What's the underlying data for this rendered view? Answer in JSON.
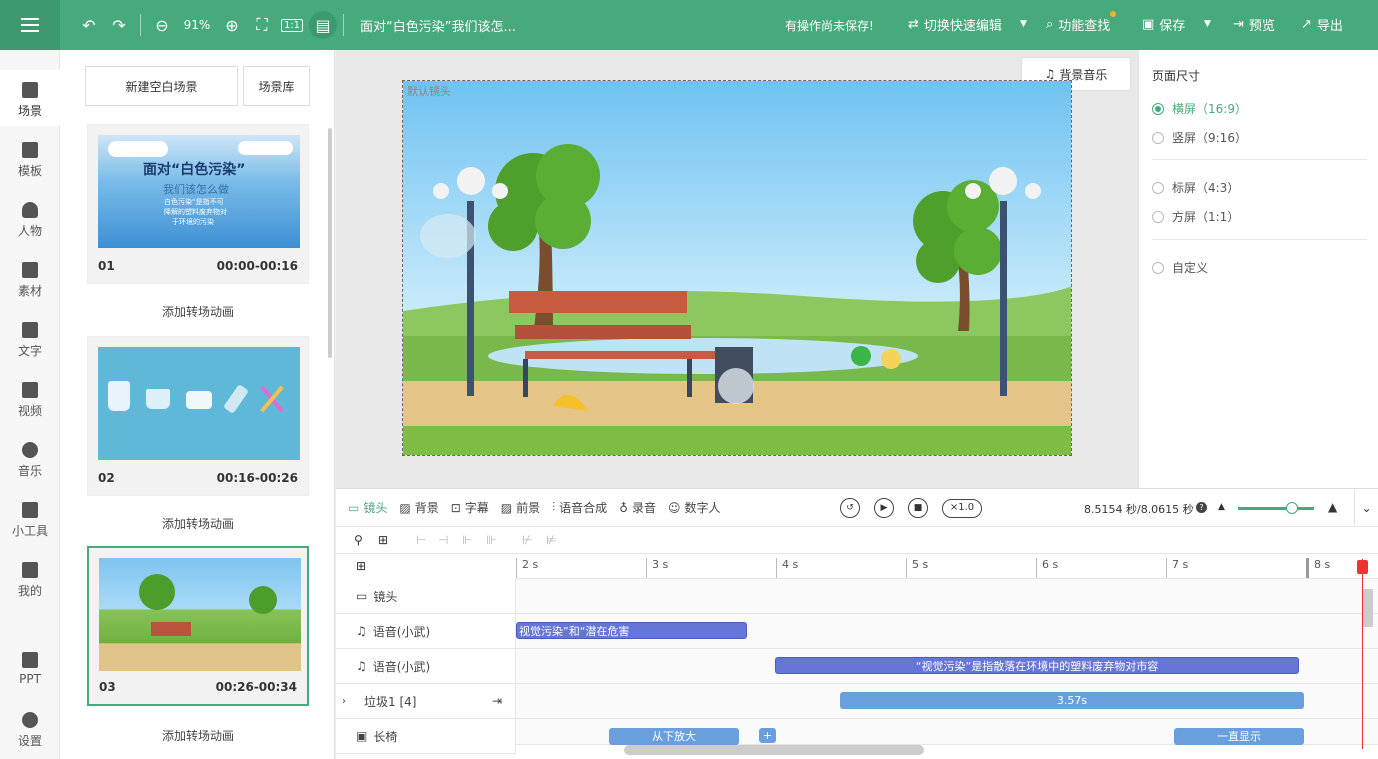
{
  "topbar": {
    "zoom": "91%",
    "doc_title": "面对“白色污染”我们该怎...",
    "unsaved": "有操作尚未保存!",
    "switch_label": "切换快速编辑",
    "find_label": "功能查找",
    "save_label": "保存",
    "preview_label": "预览",
    "export_label": "导出",
    "accent": "#47aa7c"
  },
  "leftnav": {
    "items": [
      {
        "label": "场景",
        "icon": "scene-icon"
      },
      {
        "label": "模板",
        "icon": "template-icon"
      },
      {
        "label": "人物",
        "icon": "person-icon"
      },
      {
        "label": "素材",
        "icon": "material-icon"
      },
      {
        "label": "文字",
        "icon": "text-icon"
      },
      {
        "label": "视频",
        "icon": "video-icon"
      },
      {
        "label": "音乐",
        "icon": "music-icon"
      },
      {
        "label": "小工具",
        "icon": "toolbox-icon"
      },
      {
        "label": "我的",
        "icon": "upload-icon"
      },
      {
        "label": "PPT",
        "icon": "ppt-icon"
      },
      {
        "label": "设置",
        "icon": "gear-icon"
      }
    ]
  },
  "scenes": {
    "new_blank": "新建空白场景",
    "library": "场景库",
    "add_transition": "添加转场动画",
    "items": [
      {
        "num": "01",
        "time": "00:00-00:16",
        "thumb_title": "面对“白色污染”",
        "thumb_sub": "我们该怎么做",
        "thumb_body": [
          "白色污染“是指不可",
          "降解的塑料废弃物对",
          "于环境的污染"
        ]
      },
      {
        "num": "02",
        "time": "00:16-00:26"
      },
      {
        "num": "03",
        "time": "00:26-00:34"
      }
    ]
  },
  "canvas": {
    "bg_music": "背景音乐",
    "cam_label": "默认镜头"
  },
  "page_size": {
    "title": "页面尺寸",
    "options": [
      {
        "label": "横屏（16:9）",
        "selected": true
      },
      {
        "label": "竖屏（9:16）",
        "selected": false
      },
      {
        "label": "标屏（4:3）",
        "selected": false
      },
      {
        "label": "方屏（1:1）",
        "selected": false
      },
      {
        "label": "自定义",
        "selected": false
      }
    ]
  },
  "timeline": {
    "tabs": [
      "镜头",
      "背景",
      "字幕",
      "前景",
      "语音合成",
      "录音",
      "数字人"
    ],
    "speed": "×1.0",
    "timecode": "8.5154 秒/8.0615 秒",
    "ticks": [
      "2 s",
      "3 s",
      "4 s",
      "5 s",
      "6 s",
      "7 s",
      "8 s"
    ],
    "tracks": [
      {
        "label": "镜头",
        "icon": "camera-icon"
      },
      {
        "label": "语音(小武)",
        "icon": "music-note-icon"
      },
      {
        "label": "语音(小武)",
        "icon": "music-note-icon"
      },
      {
        "label": "垃圾1 [4]",
        "icon": "chevron-right-icon"
      },
      {
        "label": "长椅",
        "icon": "image-icon"
      }
    ],
    "clips": {
      "voice1": "视觉污染”和“潜在危害",
      "voice2": "“视觉污染”是指散落在环境中的塑料废弃物对市容",
      "garbage": "3.57s",
      "bench_in": "从下放大",
      "bench_plus": "+",
      "bench_show": "一直显示"
    }
  }
}
